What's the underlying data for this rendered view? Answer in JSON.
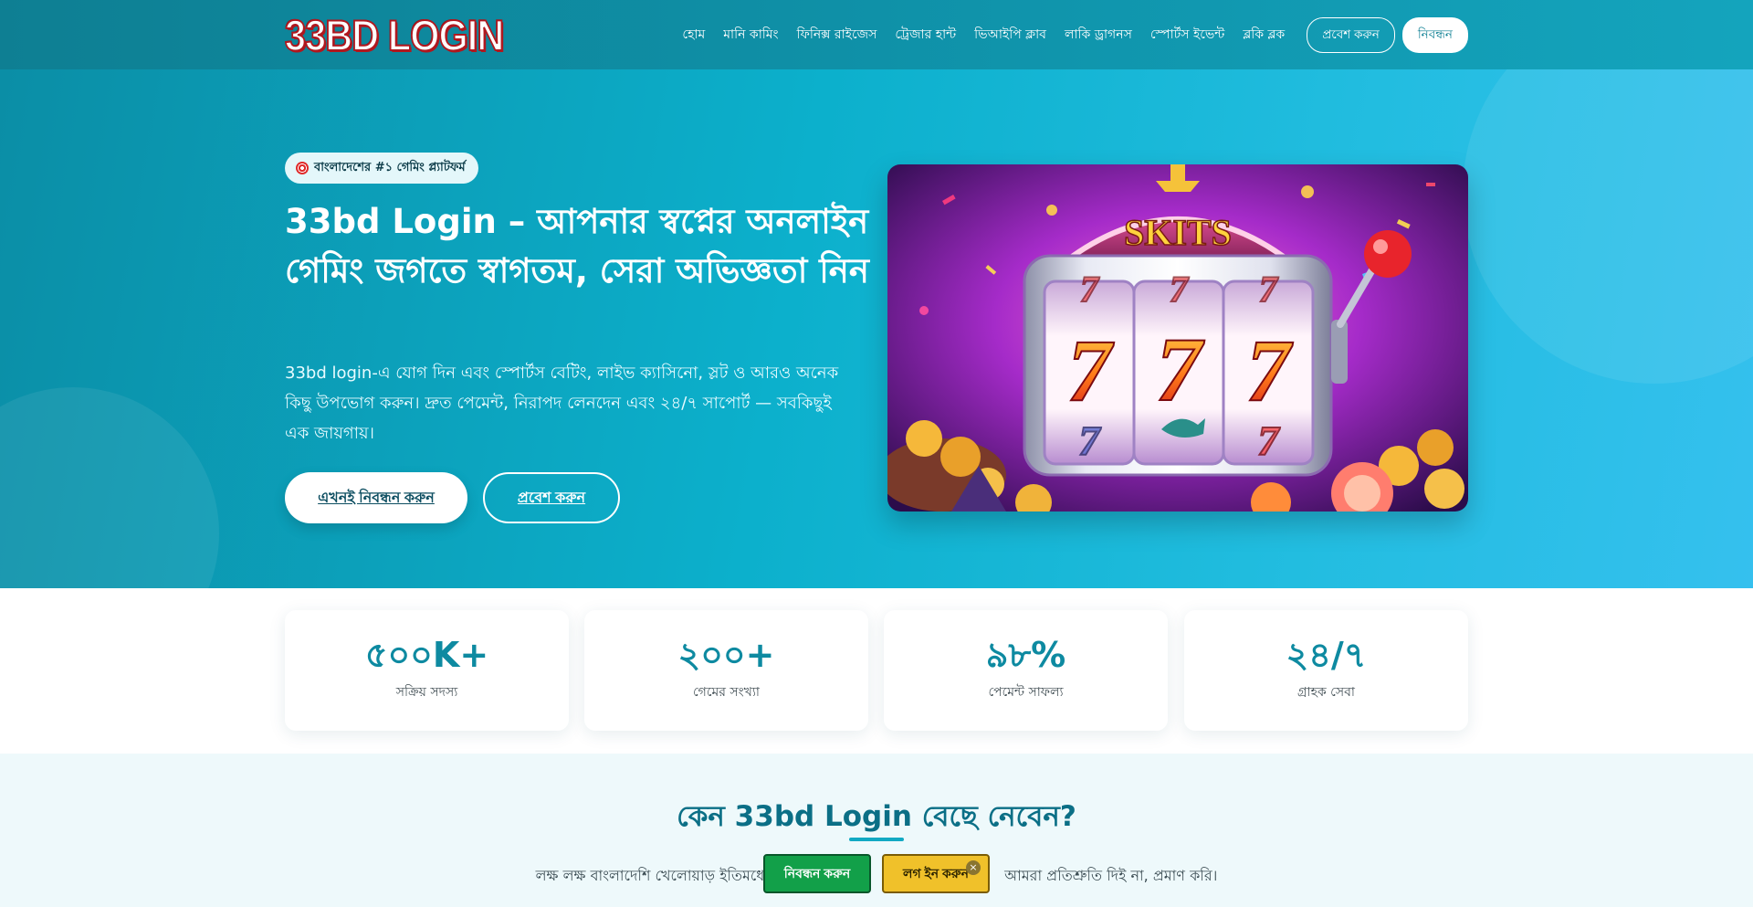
{
  "header": {
    "logo": "33BD LOGIN",
    "nav": [
      "হোম",
      "মানি কামিং",
      "ফিনিক্স রাইজেস",
      "ট্রেজার হান্ট",
      "ভিআইপি ক্লাব",
      "লাকি ড্রাগনস",
      "স্পোর্টস ইভেন্ট",
      "ব্লকি ব্লক"
    ],
    "login_button": "প্রবেশ করুন",
    "register_button": "নিবন্ধন"
  },
  "hero": {
    "badge": "বাংলাদেশের #১ গেমিং প্ল্যাটফর্ম",
    "title": "33bd Login – আপনার স্বপ্নের অনলাইন গেমিং জগতে স্বাগতম, সেরা অভিজ্ঞতা নিন",
    "description": "33bd login-এ যোগ দিন এবং স্পোর্টস বেটিং, লাইভ ক্যাসিনো, স্লট ও আরও অনেক কিছু উপভোগ করুন। দ্রুত পেমেন্ট, নিরাপদ লেনদেন এবং ২৪/৭ সাপোর্ট — সবকিছুই এক জায়গায়।",
    "primary_button": "এখনই নিবন্ধন করুন",
    "secondary_button": "প্রবেশ করুন",
    "image_sign": "SKITS"
  },
  "stats": [
    {
      "value": "৫০০K+",
      "label": "সক্রিয় সদস্য"
    },
    {
      "value": "২০০+",
      "label": "গেমের সংখ্যা"
    },
    {
      "value": "৯৮%",
      "label": "পেমেন্ট সাফল্য"
    },
    {
      "value": "২৪/৭",
      "label": "গ্রাহক সেবা"
    }
  ],
  "why": {
    "title": "কেন 33bd Login বেছে নেবেন?",
    "text_left": "লক্ষ লক্ষ বাংলাদেশি খেলোয়াড় ইতিমধ্যে",
    "text_right": "আমরা প্রতিশ্রুতি দিই না, প্রমাণ করি।"
  },
  "floating": {
    "register": "নিবন্ধন করুন",
    "login": "লগ ইন করুন",
    "close": "×"
  }
}
